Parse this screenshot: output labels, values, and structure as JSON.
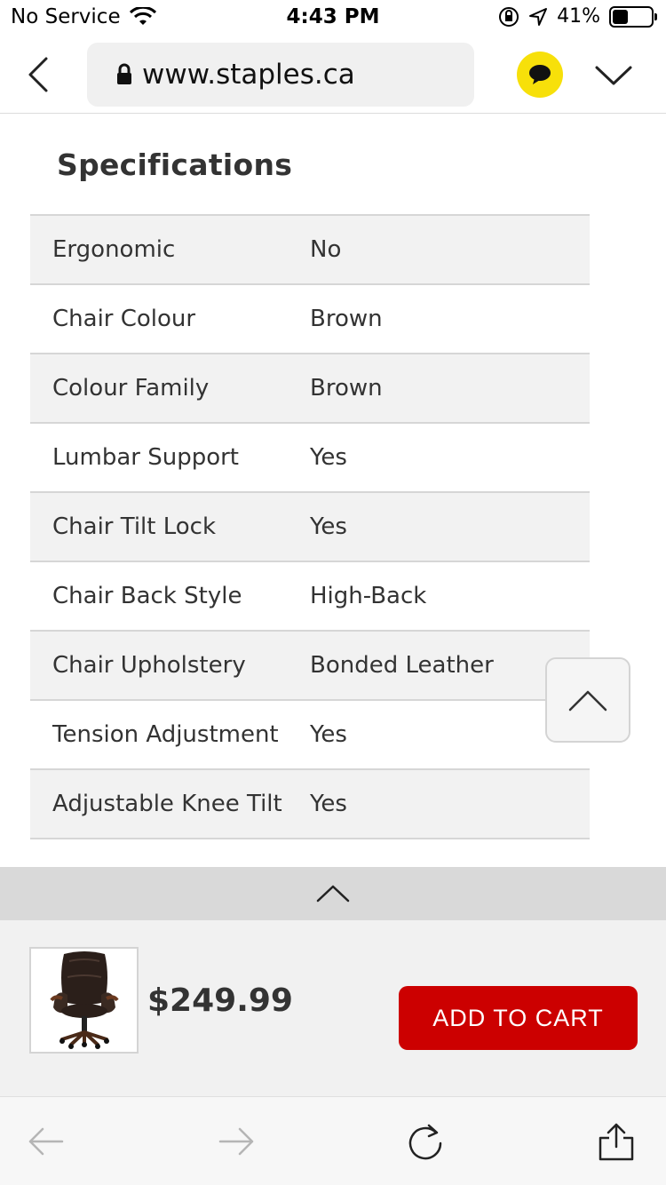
{
  "status_bar": {
    "carrier": "No Service",
    "time": "4:43 PM",
    "battery_percent": "41%",
    "battery_level": 0.41,
    "icons": [
      "wifi-icon",
      "orientation-lock-icon",
      "location-arrow-icon",
      "battery-icon"
    ]
  },
  "browser": {
    "url": "www.staples.ca",
    "icons": [
      "back-chevron-icon",
      "lock-icon",
      "chat-icon",
      "chevron-down-icon"
    ],
    "accent_color": "#f7e00a"
  },
  "specifications": {
    "title": "Specifications",
    "rows": [
      {
        "label": "Ergonomic",
        "value": "No"
      },
      {
        "label": "Chair Colour",
        "value": "Brown"
      },
      {
        "label": "Colour Family",
        "value": "Brown"
      },
      {
        "label": "Lumbar Support",
        "value": "Yes"
      },
      {
        "label": "Chair Tilt Lock",
        "value": "Yes"
      },
      {
        "label": "Chair Back Style",
        "value": "High-Back"
      },
      {
        "label": "Chair Upholstery",
        "value": "Bonded Leather"
      },
      {
        "label": "Tension Adjustment",
        "value": "Yes"
      },
      {
        "label": "Adjustable Knee Tilt",
        "value": "Yes"
      }
    ]
  },
  "product_bar": {
    "price": "$249.99",
    "add_to_cart_label": "ADD TO CART",
    "button_color": "#cc0000"
  },
  "toolbar": {
    "icons": [
      "back-arrow-icon",
      "forward-arrow-icon",
      "reload-icon",
      "share-icon"
    ]
  }
}
